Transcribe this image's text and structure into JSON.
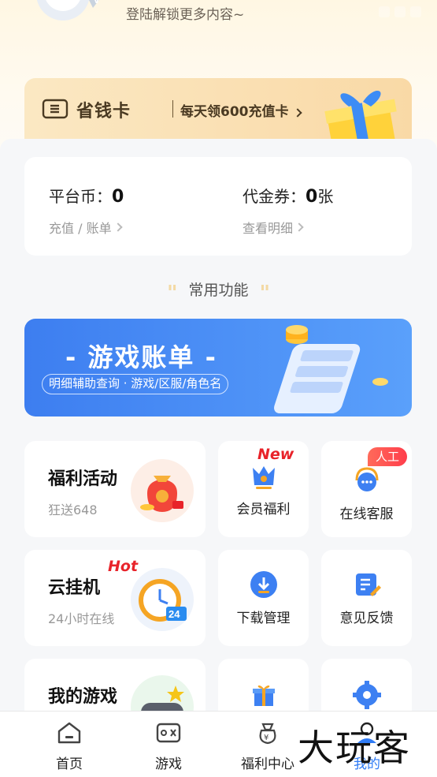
{
  "header": {
    "login_hint": "登陆解锁更多内容~"
  },
  "vip_card": {
    "title": "省钱卡",
    "promo": "每天领600充值卡"
  },
  "wallet": {
    "coins_label": "平台币：",
    "coins_value": "0",
    "coins_sub": "充值 / 账单",
    "voucher_label": "代金券：",
    "voucher_value": "0",
    "voucher_unit": "张",
    "voucher_sub": "查看明细"
  },
  "section": {
    "title": "常用功能"
  },
  "bill_banner": {
    "title": "- 游戏账单 -",
    "subtitle": "明细辅助查询 · 游戏/区服/角色名"
  },
  "tiles": {
    "welfare": {
      "title": "福利活动",
      "sub": "狂送648"
    },
    "member": {
      "label": "会员福利",
      "badge": "New"
    },
    "service": {
      "label": "在线客服",
      "badge": "人工"
    },
    "cloud": {
      "title": "云挂机",
      "sub": "24小时在线",
      "badge": "Hot"
    },
    "download": {
      "label": "下载管理"
    },
    "feedback": {
      "label": "意见反馈"
    },
    "mygames": {
      "title": "我的游戏"
    }
  },
  "tabbar": {
    "items": [
      {
        "label": "首页",
        "icon": "home-icon"
      },
      {
        "label": "游戏",
        "icon": "gamepad-icon"
      },
      {
        "label": "福利中心",
        "icon": "money-bag-icon"
      },
      {
        "label": "我的",
        "icon": "user-icon"
      }
    ]
  },
  "watermark": "大玩客",
  "colors": {
    "accent": "#2f7bf5",
    "badge_red": "#e8232a",
    "gold": "#f9d9a6"
  }
}
